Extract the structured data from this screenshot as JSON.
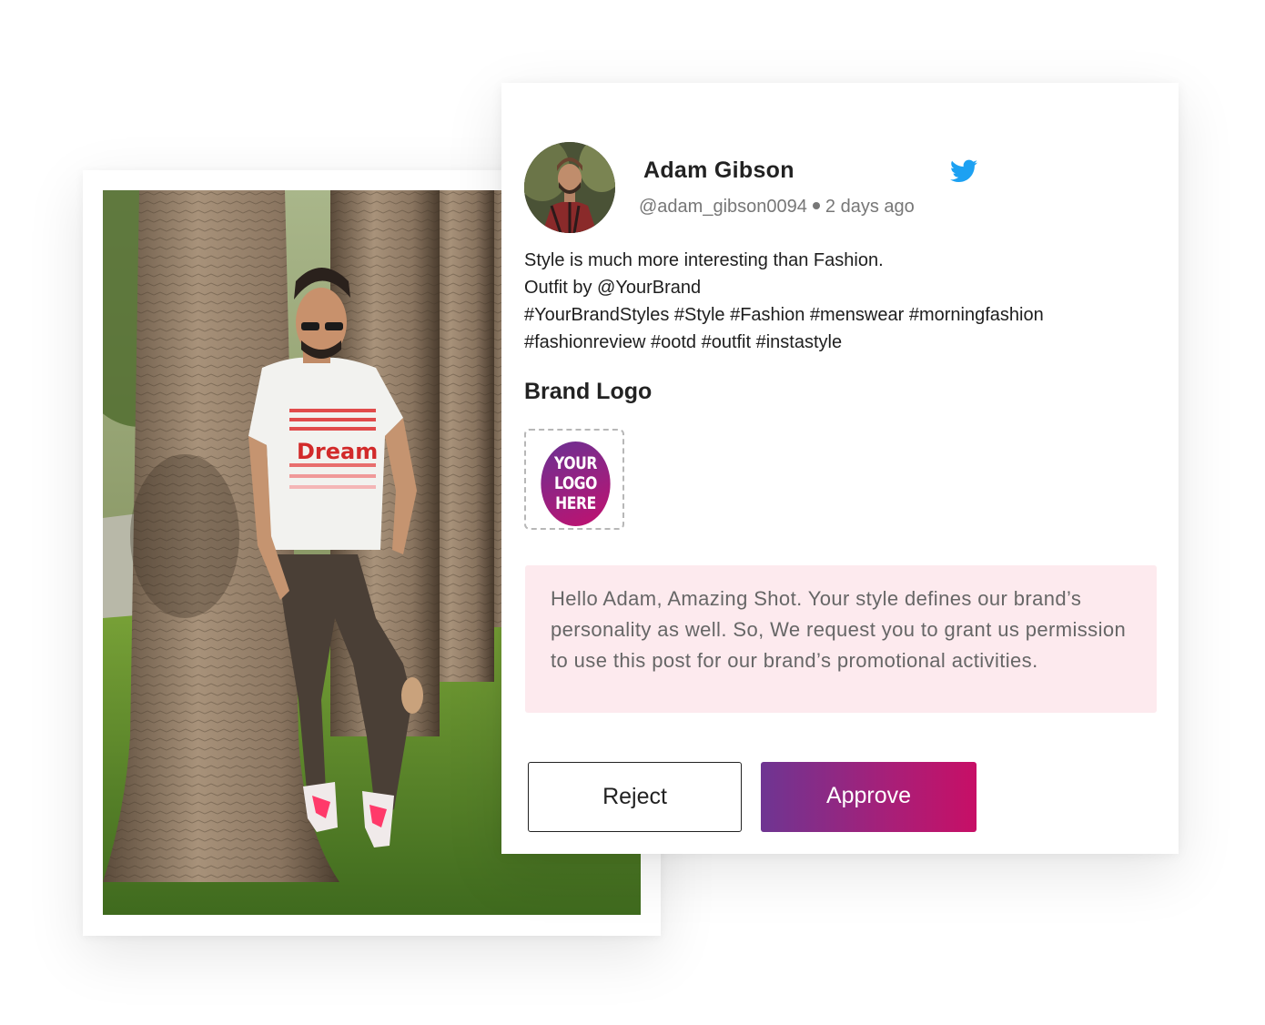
{
  "post": {
    "author_name": "Adam Gibson",
    "handle": "@adam_gibson0094",
    "time_ago": "2 days ago",
    "network_icon": "twitter-bird-icon",
    "lines": [
      "Style is much more interesting than Fashion.",
      "Outfit by @YourBrand",
      "#YourBrandStyles #Style #Fashion #menswear #morningfashion",
      "#fashionreview #ootd #outfit #instastyle"
    ]
  },
  "brand_logo": {
    "heading": "Brand Logo",
    "logo_lines": [
      "YOUR",
      "LOGO",
      "HERE"
    ]
  },
  "request": {
    "message": "Hello Adam, Amazing Shot. Your style defines our brand’s personality as well. So, We request you to grant us permission to use this post for our brand’s promotional activities."
  },
  "actions": {
    "reject_label": "Reject",
    "approve_label": "Approve"
  },
  "photo": {
    "shirt_print": "Dream"
  },
  "colors": {
    "twitter_blue": "#1da1f2",
    "message_bg": "#fdeaee",
    "approve_gradient_start": "#6e3592",
    "approve_gradient_end": "#c70f66"
  }
}
